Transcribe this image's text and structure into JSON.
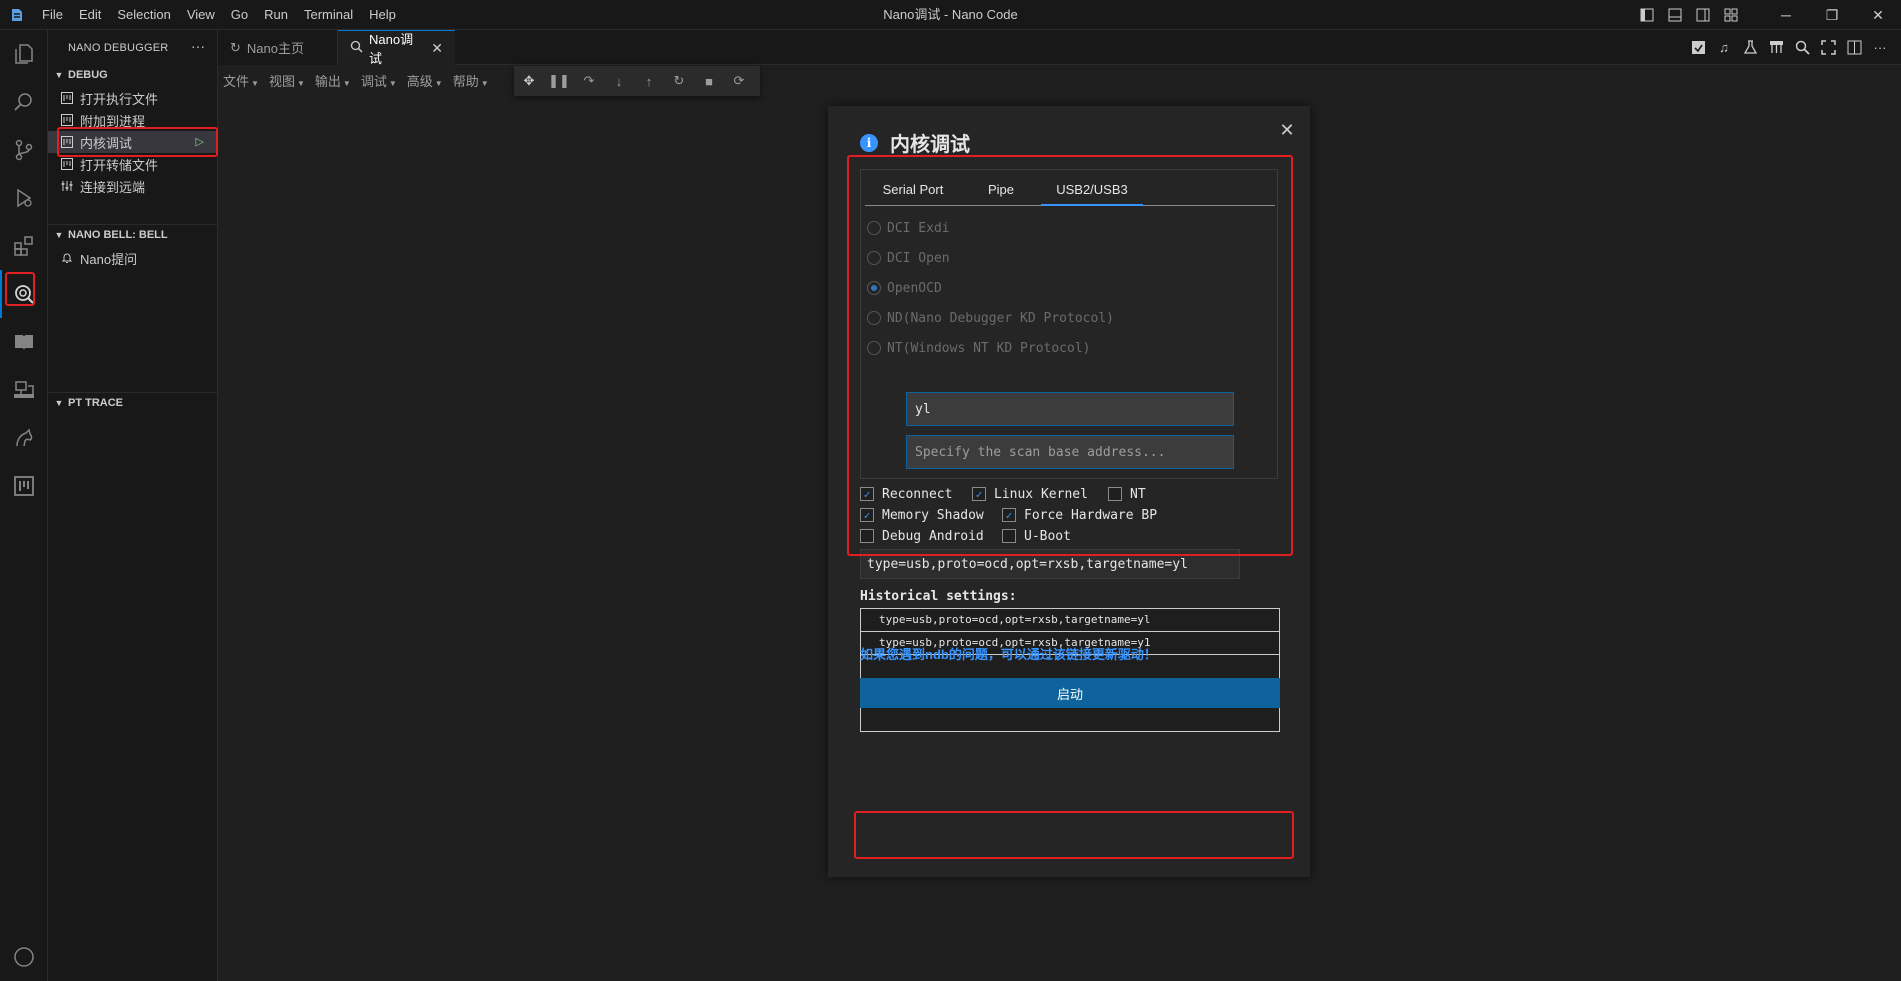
{
  "window": {
    "title": "Nano调试 - Nano Code"
  },
  "menubar": [
    "File",
    "Edit",
    "Selection",
    "View",
    "Go",
    "Run",
    "Terminal",
    "Help"
  ],
  "sidebar": {
    "title": "NANO DEBUGGER",
    "more": "···",
    "debug_section": {
      "label": "DEBUG",
      "items": [
        {
          "label": "打开执行文件"
        },
        {
          "label": "附加到进程"
        },
        {
          "label": "内核调试"
        },
        {
          "label": "打开转储文件"
        },
        {
          "label": "连接到远端"
        }
      ]
    },
    "bell_section": {
      "label": "NANO BELL: BELL",
      "items": [
        {
          "label": "Nano提问"
        }
      ]
    },
    "pt_section": {
      "label": "PT TRACE"
    }
  },
  "tabs": [
    {
      "label": "Nano主页"
    },
    {
      "label": "Nano调试",
      "close": "✕"
    }
  ],
  "toolbar": {
    "menus": [
      "文件",
      "视图",
      "输出",
      "调试",
      "高级",
      "帮助"
    ]
  },
  "dialog": {
    "title": "内核调试",
    "close": "✕",
    "conn_tabs": [
      "Serial Port",
      "Pipe",
      "USB2/USB3"
    ],
    "active_conn_tab": "USB2/USB3",
    "protocols": [
      {
        "label": "DCI Exdi",
        "selected": false
      },
      {
        "label": "DCI Open",
        "selected": false
      },
      {
        "label": "OpenOCD",
        "selected": true
      },
      {
        "label": "ND(Nano Debugger KD Protocol)",
        "selected": false
      },
      {
        "label": "NT(Windows NT KD Protocol)",
        "selected": false
      }
    ],
    "target_name_value": "yl",
    "scan_base_placeholder": "Specify the scan base address...",
    "options": [
      {
        "label": "Reconnect",
        "checked": true
      },
      {
        "label": "Linux Kernel",
        "checked": true
      },
      {
        "label": "NT",
        "checked": false
      },
      {
        "label": "Memory Shadow",
        "checked": true
      },
      {
        "label": "Force Hardware BP",
        "checked": true
      },
      {
        "label": "Debug Android",
        "checked": false
      },
      {
        "label": "U-Boot",
        "checked": false
      }
    ],
    "param_string": "type=usb,proto=ocd,opt=rxsb,targetname=yl",
    "history_label": "Historical settings:",
    "history": [
      "type=usb,proto=ocd,opt=rxsb,targetname=yl",
      "type=usb,proto=ocd,opt=rxsb,targetname=y1"
    ],
    "driver_link": "如果您遇到ndb的问题，可以通过该链接更新驱动！",
    "start_button": "启动"
  },
  "colors": {
    "accent": "#0078d4",
    "highlight": "#e02020",
    "link": "#3794ff",
    "button": "#0e639c"
  }
}
